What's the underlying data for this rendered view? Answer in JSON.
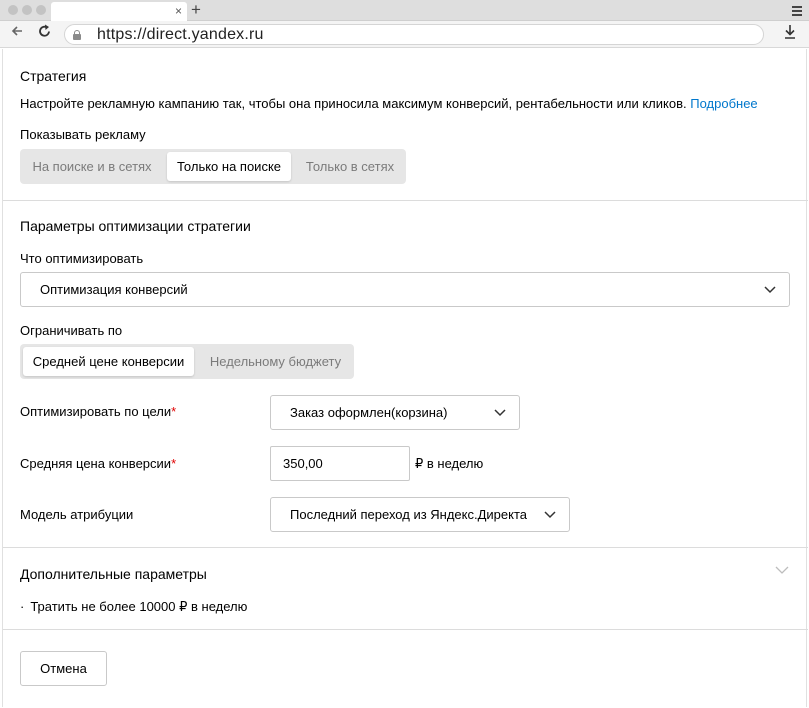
{
  "browser": {
    "url": "https://direct.yandex.ru",
    "tab_close": "×",
    "tab_new": "+"
  },
  "strategy": {
    "title": "Стратегия",
    "description": "Настройте рекламную кампанию так, чтобы она приносила максимум конверсий, рентабельности или кликов.",
    "more_link": "Подробнее",
    "show_ads_label": "Показывать рекламу",
    "show_ads_options": [
      "На поиске и в сетях",
      "Только на поиске",
      "Только в сетях"
    ],
    "show_ads_selected": "Только на поиске"
  },
  "optimization": {
    "title": "Параметры оптимизации стратегии",
    "what_label": "Что оптимизировать",
    "what_value": "Оптимизация конверсий",
    "limit_label": "Ограничивать по",
    "limit_options": [
      "Средней цене конверсии",
      "Недельному бюджету"
    ],
    "limit_selected": "Средней цене конверсии",
    "goal_label": "Оптимизировать по цели",
    "goal_value": "Заказ оформлен(корзина)",
    "avg_price_label": "Средняя цена конверсии",
    "avg_price_value": "350,00",
    "avg_price_unit": "₽ в неделю",
    "attribution_label": "Модель атрибуции",
    "attribution_value": "Последний переход из Яндекс.Директа",
    "required_mark": "*"
  },
  "extra": {
    "title": "Дополнительные параметры",
    "bullet": "·",
    "item": "Тратить не более 10000 ₽ в неделю"
  },
  "footer": {
    "cancel_label": "Отмена"
  },
  "colors": {
    "link": "#0077cc",
    "required": "#e00000",
    "segment_bg": "#e6e6e6"
  }
}
